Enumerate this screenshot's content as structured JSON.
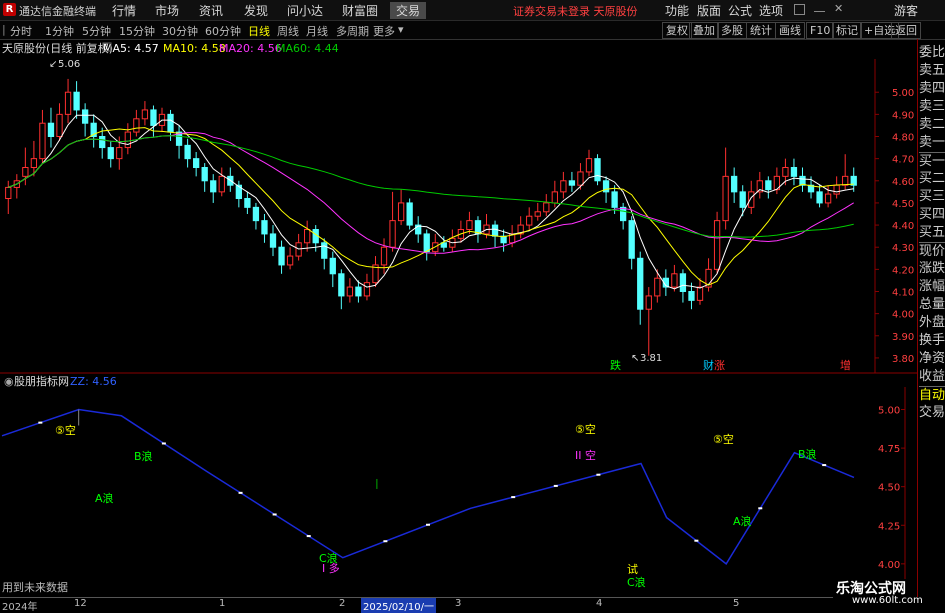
{
  "menu": {
    "app_title": "通达信金融终端",
    "items": [
      "行情",
      "市场",
      "资讯",
      "发现",
      "问小达",
      "财富圈",
      "交易"
    ],
    "active_item": "交易",
    "status": "证券交易未登录   天原股份",
    "right_items": [
      "功能",
      "版面",
      "公式",
      "选项"
    ],
    "user": "游客"
  },
  "toolbar": {
    "tabs": [
      "分时",
      "1分钟",
      "5分钟",
      "15分钟",
      "30分钟",
      "60分钟",
      "日线",
      "周线",
      "月线",
      "多周期",
      "更多"
    ],
    "active_tab": "日线",
    "buttons": [
      "复权",
      "叠加",
      "多股",
      "统计",
      "画线",
      "F10",
      "标记",
      "+自选",
      "返回"
    ]
  },
  "main_chart": {
    "title": "天原股份(日线 前复权)",
    "ma_labels": [
      {
        "label": "MA5: 4.57",
        "color": "#ffffff"
      },
      {
        "label": "MA10: 4.58",
        "color": "#ffff00"
      },
      {
        "label": "MA20: 4.56",
        "color": "#ff33ff"
      },
      {
        "label": "MA60: 4.44",
        "color": "#00cc00"
      }
    ],
    "high_label": "5.06",
    "low_label": "3.81",
    "markers": [
      {
        "text": "跌",
        "color": "#00ff00"
      },
      {
        "text": "财",
        "color": "#00ccff"
      },
      {
        "text": "涨",
        "color": "#ff3030"
      },
      {
        "text": "增",
        "color": "#ff3030"
      }
    ]
  },
  "sub_chart": {
    "title": "股朋指标网",
    "value_label": "ZZ: 4.56",
    "labels": [
      {
        "text": "⑤空",
        "color": "#ffff00"
      },
      {
        "text": "B浪",
        "color": "#00ff00"
      },
      {
        "text": "A浪",
        "color": "#00ff00"
      },
      {
        "text": "C浪",
        "color": "#00ff00"
      },
      {
        "text": "I 多",
        "color": "#ff33ff"
      },
      {
        "text": "⑤空",
        "color": "#ffff00"
      },
      {
        "text": "II 空",
        "color": "#ff33ff"
      },
      {
        "text": "试",
        "color": "#ffff00"
      },
      {
        "text": "C浪",
        "color": "#00ff00"
      },
      {
        "text": "⑤空",
        "color": "#ffff00"
      },
      {
        "text": "B浪",
        "color": "#00ff00"
      },
      {
        "text": "A浪",
        "color": "#00ff00"
      }
    ],
    "footnote": "用到未来数据"
  },
  "time_axis": {
    "labels": [
      "2024年",
      "12",
      "1",
      "2",
      "2025/02/10/一",
      "3",
      "4",
      "5"
    ]
  },
  "right_panel": {
    "items": [
      "委比",
      "卖五",
      "卖四",
      "卖三",
      "卖二",
      "卖一",
      "买一",
      "买二",
      "买三",
      "买四",
      "买五",
      "现价",
      "涨跌",
      "涨幅",
      "总量",
      "外盘",
      "换手",
      "净资",
      "收益",
      "自动",
      "交易"
    ]
  },
  "watermark": {
    "title": "乐淘公式网",
    "url": "www.60lt.com"
  },
  "chart_data": [
    {
      "type": "candlestick",
      "title": "天原股份(日线 前复权)",
      "ylim": [
        3.75,
        5.15
      ],
      "yticks": [
        5.0,
        4.9,
        4.8,
        4.7,
        4.6,
        4.5,
        4.4,
        4.3,
        4.2,
        4.1,
        4.0,
        3.9,
        3.8
      ],
      "candles": [
        [
          4.52,
          4.57,
          4.6,
          4.45
        ],
        [
          4.57,
          4.6,
          4.63,
          4.52
        ],
        [
          4.62,
          4.66,
          4.75,
          4.58
        ],
        [
          4.66,
          4.7,
          4.78,
          4.62
        ],
        [
          4.7,
          4.86,
          4.92,
          4.68
        ],
        [
          4.86,
          4.8,
          4.93,
          4.75
        ],
        [
          4.8,
          4.9,
          4.95,
          4.78
        ],
        [
          4.9,
          5.0,
          5.06,
          4.86
        ],
        [
          5.0,
          4.92,
          5.05,
          4.88
        ],
        [
          4.92,
          4.86,
          4.95,
          4.8
        ],
        [
          4.86,
          4.8,
          4.9,
          4.75
        ],
        [
          4.8,
          4.75,
          4.84,
          4.7
        ],
        [
          4.75,
          4.7,
          4.78,
          4.66
        ],
        [
          4.7,
          4.75,
          4.8,
          4.65
        ],
        [
          4.75,
          4.82,
          4.86,
          4.72
        ],
        [
          4.82,
          4.88,
          4.92,
          4.8
        ],
        [
          4.88,
          4.92,
          4.96,
          4.85
        ],
        [
          4.92,
          4.85,
          4.94,
          4.8
        ],
        [
          4.85,
          4.9,
          4.93,
          4.82
        ],
        [
          4.9,
          4.82,
          4.92,
          4.78
        ],
        [
          4.82,
          4.76,
          4.85,
          4.7
        ],
        [
          4.76,
          4.7,
          4.79,
          4.66
        ],
        [
          4.7,
          4.66,
          4.73,
          4.62
        ],
        [
          4.66,
          4.6,
          4.68,
          4.55
        ],
        [
          4.6,
          4.55,
          4.63,
          4.5
        ],
        [
          4.55,
          4.62,
          4.66,
          4.53
        ],
        [
          4.62,
          4.58,
          4.66,
          4.55
        ],
        [
          4.58,
          4.52,
          4.6,
          4.48
        ],
        [
          4.52,
          4.48,
          4.55,
          4.45
        ],
        [
          4.48,
          4.42,
          4.5,
          4.38
        ],
        [
          4.42,
          4.36,
          4.45,
          4.32
        ],
        [
          4.36,
          4.3,
          4.4,
          4.26
        ],
        [
          4.3,
          4.22,
          4.33,
          4.18
        ],
        [
          4.22,
          4.26,
          4.3,
          4.2
        ],
        [
          4.26,
          4.32,
          4.36,
          4.24
        ],
        [
          4.32,
          4.38,
          4.42,
          4.28
        ],
        [
          4.38,
          4.32,
          4.4,
          4.28
        ],
        [
          4.32,
          4.25,
          4.34,
          4.2
        ],
        [
          4.25,
          4.18,
          4.28,
          4.12
        ],
        [
          4.18,
          4.08,
          4.2,
          4.02
        ],
        [
          4.08,
          4.12,
          4.16,
          4.05
        ],
        [
          4.12,
          4.08,
          4.15,
          4.05
        ],
        [
          4.08,
          4.14,
          4.18,
          4.06
        ],
        [
          4.14,
          4.22,
          4.26,
          4.12
        ],
        [
          4.22,
          4.3,
          4.34,
          4.18
        ],
        [
          4.3,
          4.42,
          4.55,
          4.28
        ],
        [
          4.42,
          4.5,
          4.56,
          4.4
        ],
        [
          4.5,
          4.4,
          4.52,
          4.38
        ],
        [
          4.4,
          4.36,
          4.44,
          4.32
        ],
        [
          4.36,
          4.28,
          4.38,
          4.24
        ],
        [
          4.28,
          4.32,
          4.36,
          4.26
        ],
        [
          4.32,
          4.3,
          4.35,
          4.28
        ],
        [
          4.3,
          4.34,
          4.38,
          4.28
        ],
        [
          4.34,
          4.38,
          4.42,
          4.32
        ],
        [
          4.38,
          4.42,
          4.46,
          4.36
        ],
        [
          4.42,
          4.36,
          4.44,
          4.32
        ],
        [
          4.36,
          4.4,
          4.45,
          4.34
        ],
        [
          4.4,
          4.35,
          4.42,
          4.3
        ],
        [
          4.35,
          4.32,
          4.38,
          4.28
        ],
        [
          4.32,
          4.36,
          4.4,
          4.3
        ],
        [
          4.36,
          4.4,
          4.44,
          4.34
        ],
        [
          4.4,
          4.44,
          4.48,
          4.38
        ],
        [
          4.44,
          4.46,
          4.5,
          4.42
        ],
        [
          4.46,
          4.5,
          4.54,
          4.44
        ],
        [
          4.5,
          4.55,
          4.6,
          4.48
        ],
        [
          4.55,
          4.6,
          4.64,
          4.52
        ],
        [
          4.6,
          4.58,
          4.64,
          4.55
        ],
        [
          4.58,
          4.64,
          4.68,
          4.56
        ],
        [
          4.64,
          4.7,
          4.74,
          4.62
        ],
        [
          4.7,
          4.6,
          4.72,
          4.58
        ],
        [
          4.6,
          4.55,
          4.62,
          4.5
        ],
        [
          4.55,
          4.48,
          4.58,
          4.45
        ],
        [
          4.48,
          4.42,
          4.5,
          4.38
        ],
        [
          4.42,
          4.25,
          4.44,
          4.2
        ],
        [
          4.25,
          4.02,
          4.28,
          3.95
        ],
        [
          4.02,
          4.08,
          4.12,
          3.81
        ],
        [
          4.08,
          4.16,
          4.2,
          4.05
        ],
        [
          4.16,
          4.12,
          4.2,
          4.08
        ],
        [
          4.12,
          4.18,
          4.22,
          4.1
        ],
        [
          4.18,
          4.1,
          4.2,
          4.05
        ],
        [
          4.1,
          4.06,
          4.14,
          4.02
        ],
        [
          4.06,
          4.12,
          4.16,
          4.04
        ],
        [
          4.12,
          4.2,
          4.25,
          4.1
        ],
        [
          4.2,
          4.42,
          4.46,
          4.18
        ],
        [
          4.42,
          4.62,
          4.75,
          4.38
        ],
        [
          4.62,
          4.55,
          4.66,
          4.5
        ],
        [
          4.55,
          4.48,
          4.58,
          4.44
        ],
        [
          4.48,
          4.55,
          4.6,
          4.45
        ],
        [
          4.55,
          4.6,
          4.64,
          4.52
        ],
        [
          4.6,
          4.56,
          4.62,
          4.52
        ],
        [
          4.56,
          4.62,
          4.66,
          4.54
        ],
        [
          4.62,
          4.66,
          4.7,
          4.58
        ],
        [
          4.66,
          4.62,
          4.7,
          4.58
        ],
        [
          4.62,
          4.58,
          4.66,
          4.55
        ],
        [
          4.58,
          4.55,
          4.62,
          4.52
        ],
        [
          4.55,
          4.5,
          4.58,
          4.48
        ],
        [
          4.5,
          4.54,
          4.58,
          4.48
        ],
        [
          4.54,
          4.58,
          4.62,
          4.52
        ],
        [
          4.58,
          4.62,
          4.72,
          4.56
        ],
        [
          4.62,
          4.58,
          4.66,
          4.55
        ]
      ],
      "series": [
        {
          "name": "MA5",
          "color": "#ffffff"
        },
        {
          "name": "MA10",
          "color": "#ffff00"
        },
        {
          "name": "MA20",
          "color": "#ff33ff"
        },
        {
          "name": "MA60",
          "color": "#00cc00"
        }
      ]
    },
    {
      "type": "line",
      "title": "股朋指标网",
      "ylim": [
        3.85,
        5.12
      ],
      "yticks": [
        5.0,
        4.75,
        4.5,
        4.25,
        4.0
      ],
      "x": [
        0,
        9,
        14,
        24,
        40,
        55,
        75,
        78,
        85,
        93,
        100
      ],
      "values": [
        4.83,
        5.0,
        4.96,
        4.6,
        4.04,
        4.36,
        4.65,
        4.3,
        4.0,
        4.72,
        4.56
      ]
    }
  ]
}
